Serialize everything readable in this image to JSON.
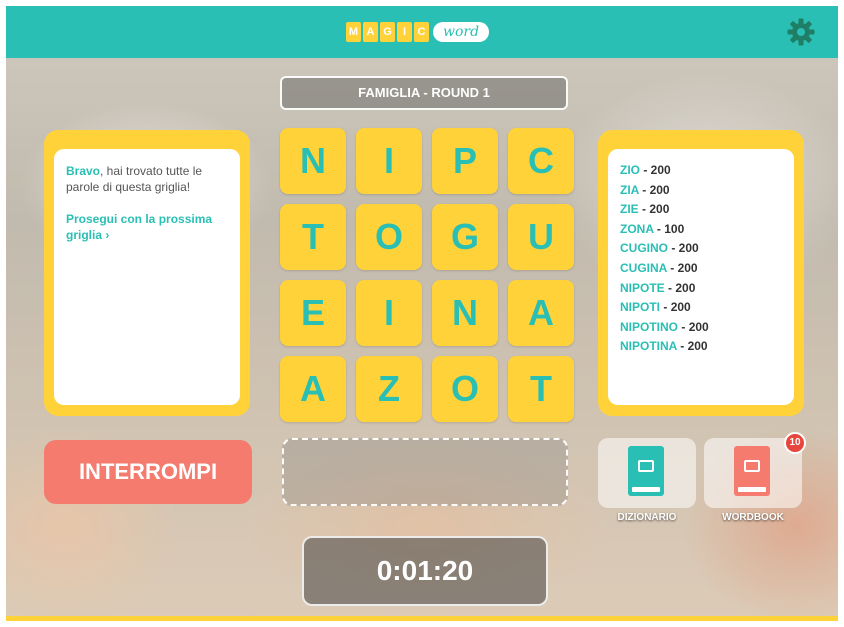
{
  "header": {
    "logo_letters": [
      "M",
      "A",
      "G",
      "I",
      "C"
    ],
    "logo_word": "word",
    "settings_icon": "gear-icon",
    "bar_color": "#2abfb4"
  },
  "round": {
    "title": "FAMIGLIA - ROUND 1"
  },
  "message": {
    "strong": "Bravo",
    "text": ", hai trovato tutte le parole di questa griglia!",
    "next": "Prosegui con la prossima griglia ›"
  },
  "grid": {
    "letters": [
      "N",
      "I",
      "P",
      "C",
      "T",
      "O",
      "G",
      "U",
      "E",
      "I",
      "N",
      "A",
      "A",
      "Z",
      "O",
      "T"
    ]
  },
  "words": [
    {
      "word": "ZIO",
      "points": "200"
    },
    {
      "word": "ZIA",
      "points": "200"
    },
    {
      "word": "ZIE",
      "points": "200"
    },
    {
      "word": "ZONA",
      "points": "100"
    },
    {
      "word": "CUGINO",
      "points": "200"
    },
    {
      "word": "CUGINA",
      "points": "200"
    },
    {
      "word": "NIPOTE",
      "points": "200"
    },
    {
      "word": "NIPOTI",
      "points": "200"
    },
    {
      "word": "NIPOTINO",
      "points": "200"
    },
    {
      "word": "NIPOTINA",
      "points": "200"
    }
  ],
  "controls": {
    "stop_label": "INTERROMPI",
    "dictionary_label": "DIZIONARIO",
    "wordbook_label": "WORDBOOK",
    "wordbook_badge": "10",
    "dictionary_icon": "dictionary-book-icon",
    "wordbook_icon": "wordbook-icon"
  },
  "timer": {
    "value": "0:01:20"
  },
  "colors": {
    "accent": "#2abfb4",
    "tile": "#ffd23a",
    "stop": "#f47b6e",
    "badge": "#e8453c"
  }
}
